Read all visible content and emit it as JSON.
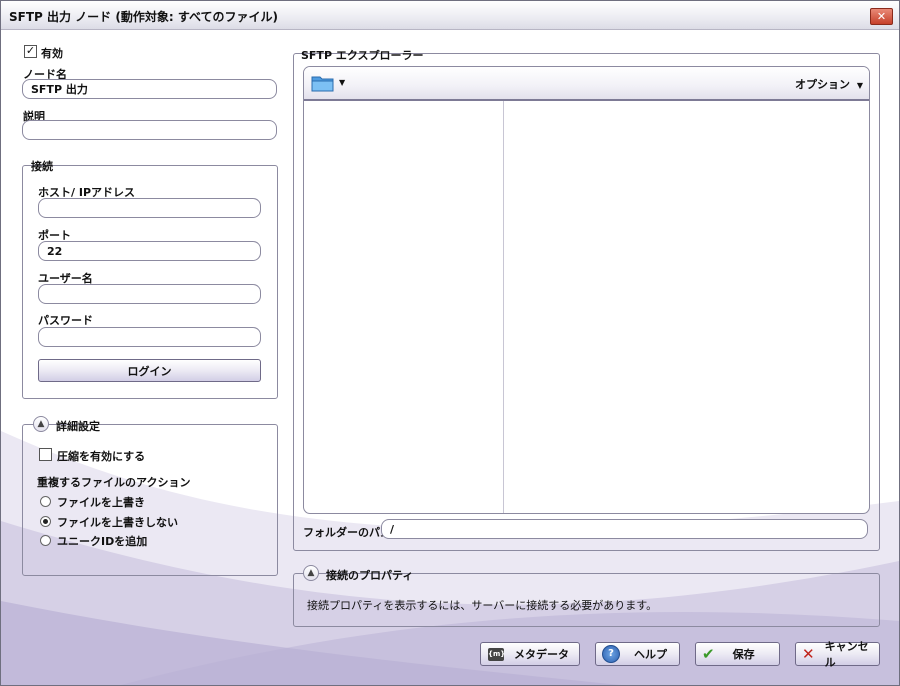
{
  "window": {
    "title": "SFTP 出力 ノード (動作対象: すべてのファイル)",
    "close_glyph": "✕"
  },
  "general": {
    "enabled_label": "有効",
    "enabled_checked": true,
    "node_name_label": "ノード名",
    "node_name_value": "SFTP 出力",
    "description_label": "説明",
    "description_value": ""
  },
  "connection": {
    "group_label": "接続",
    "host_label": "ホスト/ IPアドレス",
    "host_value": "",
    "port_label": "ポート",
    "port_value": "22",
    "username_label": "ユーザー名",
    "username_value": "",
    "password_label": "パスワード",
    "password_value": "",
    "login_button": "ログイン"
  },
  "advanced": {
    "group_label": "詳細設定",
    "compress_label": "圧縮を有効にする",
    "compress_checked": false,
    "duplicate_label": "重複するファイルのアクション",
    "options": [
      {
        "label": "ファイルを上書き",
        "selected": false
      },
      {
        "label": "ファイルを上書きしない",
        "selected": true
      },
      {
        "label": "ユニークIDを追加",
        "selected": false
      }
    ]
  },
  "explorer": {
    "group_label": "SFTP エクスプローラー",
    "options_label": "オプション",
    "folder_icon": "folder-icon",
    "folder_path_label": "フォルダーのパス",
    "folder_path_value": "/"
  },
  "conn_props": {
    "group_label": "接続のプロパティ",
    "message": "接続プロパティを表示するには、サーバーに接続する必要があります。"
  },
  "footer": {
    "metadata_button": "メタデータ",
    "help_button": "ヘルプ",
    "save_button": "保存",
    "cancel_button": "キャンセル"
  },
  "colors": {
    "accent": "#7b6fb0",
    "border": "#8c8aa0",
    "cancel_x": "#c0241c",
    "save_check": "#3b9a2a"
  }
}
